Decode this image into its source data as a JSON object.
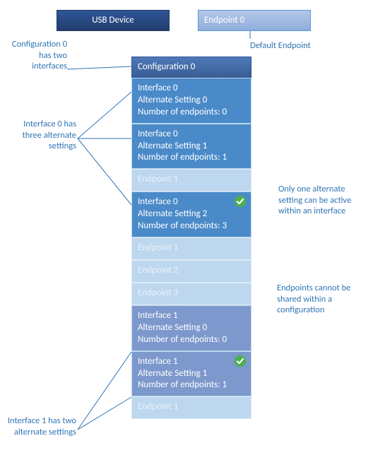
{
  "headers": {
    "usb_device": "USB Device",
    "endpoint0": "Endpoint 0"
  },
  "config": {
    "title": "Configuration 0"
  },
  "stack": [
    {
      "kind": "iface0",
      "lines": [
        "Interface 0",
        "Alternate Setting 0",
        "Number of endpoints: 0"
      ]
    },
    {
      "kind": "iface0",
      "lines": [
        "Interface 0",
        "Alternate Setting 1",
        "Number of endpoints: 1"
      ]
    },
    {
      "kind": "endpoint",
      "label": "Endpoint 1"
    },
    {
      "kind": "iface0",
      "lines": [
        "Interface 0",
        "Alternate Setting 2",
        "Number of endpoints: 3"
      ],
      "checked": true
    },
    {
      "kind": "endpoint",
      "label": "Endpoint 1"
    },
    {
      "kind": "endpoint",
      "label": "Endpoint 2"
    },
    {
      "kind": "endpoint",
      "label": "Endpoint 3"
    },
    {
      "kind": "iface1",
      "lines": [
        "Interface 1",
        "Alternate Setting 0",
        "Number of endpoints: 0"
      ]
    },
    {
      "kind": "iface1",
      "lines": [
        "Interface 1",
        "Alternate Setting 1",
        "Number of endpoints: 1"
      ],
      "checked": true
    },
    {
      "kind": "endpoint",
      "label": "Endpoint 1"
    }
  ],
  "annotations": {
    "config_two_ifaces": "Configuration 0 has two interfaces",
    "default_endpoint": "Default Endpoint",
    "iface0_three_alt": "Interface 0 has three alternate settings",
    "only_one_active": "Only one alternate setting can be active within an interface",
    "endpoints_not_shared": "Endpoints cannot be shared within a configuration",
    "iface1_two_alt": "Interface 1 has two alternate settings"
  }
}
